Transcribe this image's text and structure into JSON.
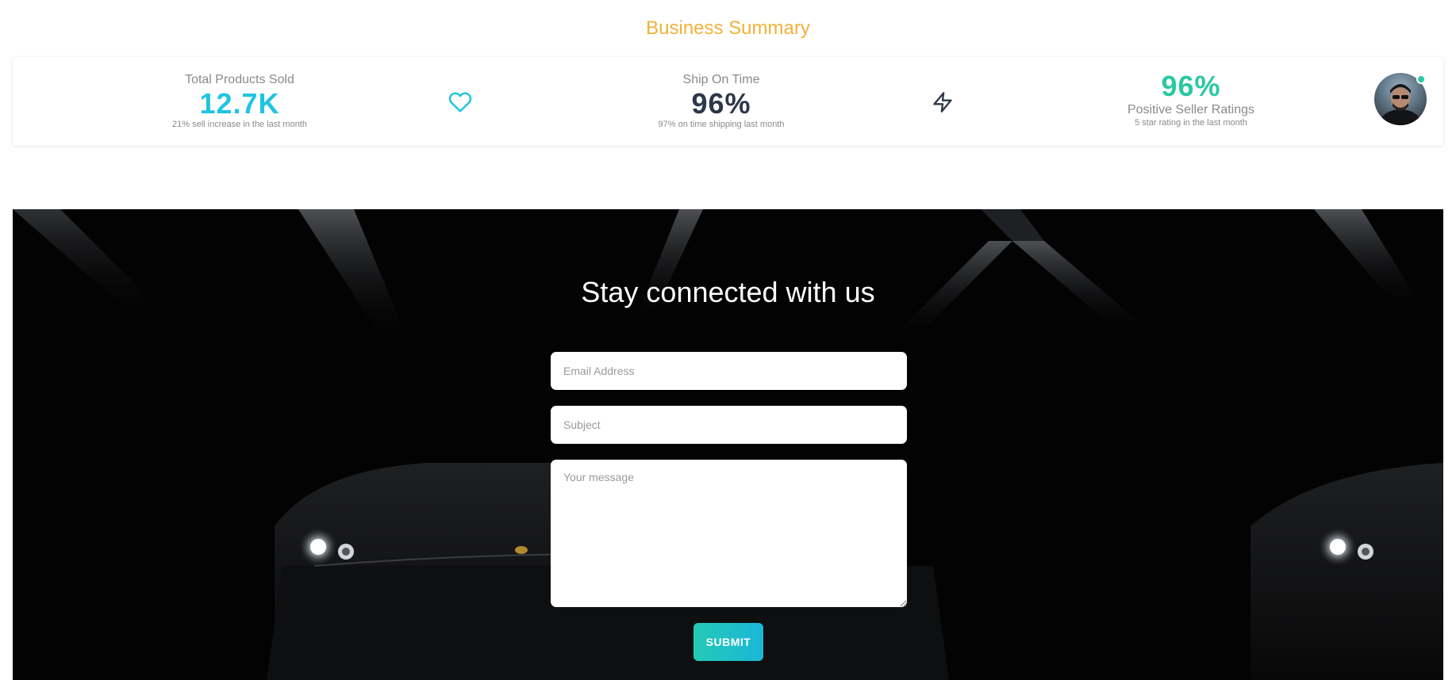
{
  "summary": {
    "title": "Business Summary",
    "stats": [
      {
        "label": "Total Products Sold",
        "value": "12.7K",
        "note": "21% sell increase in the last month",
        "color": "#1fc4e2"
      },
      {
        "label": "Ship On Time",
        "value": "96%",
        "note": "97% on time shipping last month",
        "color": "#2d3748"
      },
      {
        "label": "Positive Seller Ratings",
        "value": "96%",
        "note": "5 star rating in the last month",
        "color": "#2bc8a3"
      }
    ],
    "icons": [
      "heart-icon",
      "bolt-icon"
    ],
    "avatar_status": "online",
    "accent_color": "#f0b23c"
  },
  "contact": {
    "title": "Stay connected with us",
    "email_placeholder": "Email Address",
    "subject_placeholder": "Subject",
    "message_placeholder": "Your message",
    "submit_label": "SUBMIT",
    "button_gradient": [
      "#25c9b5",
      "#1ab7d8"
    ]
  }
}
